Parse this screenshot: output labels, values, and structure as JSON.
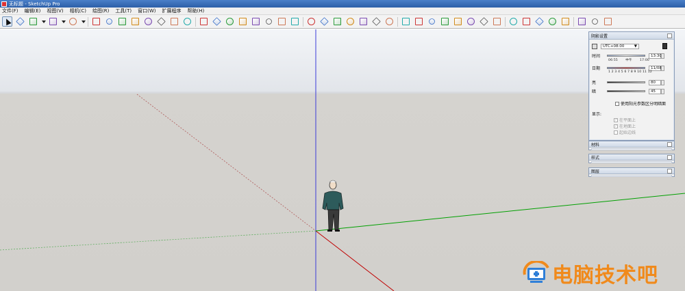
{
  "window": {
    "title": "无标题 - SketchUp Pro"
  },
  "menu": [
    "文件(F)",
    "编辑(E)",
    "视图(V)",
    "相机(C)",
    "绘图(R)",
    "工具(T)",
    "窗口(W)",
    "扩展程序",
    "帮助(H)"
  ],
  "toolbar": {
    "tools": [
      "select-icon",
      "eraser-icon",
      "pencil-icon",
      "dropdown-icon",
      "arc-icon",
      "dropdown-icon",
      "rectangle-icon",
      "dropdown-icon",
      "push-pull-icon",
      "offset-icon",
      "move-icon",
      "rotate-icon",
      "scale-icon",
      "tape-measure-icon",
      "text-icon",
      "protractor-icon",
      "paint-bucket-icon",
      "orbit-icon",
      "pan-icon",
      "zoom-icon",
      "zoom-extents-icon",
      "components-icon",
      "warehouse-icon",
      "extension-icon",
      "section-icon",
      "view-iso-icon",
      "view-top-icon",
      "view-front-icon",
      "view-right-icon",
      "view-back-icon",
      "view-left-icon",
      "sandbox-icon",
      "smoove-icon",
      "stamp-icon",
      "drape-icon",
      "add-detail-icon",
      "flip-edge-icon",
      "follow-me-icon",
      "intersect-icon",
      "solid-union-icon",
      "solid-subtract-icon",
      "solid-trim-icon",
      "solid-split-icon",
      "outer-shell-icon",
      "shadows-icon",
      "fog-icon",
      "layout-icon"
    ],
    "selected_tool": 0
  },
  "colors": {
    "blue_axis": "#1a1ad0",
    "red_axis": "#c00000",
    "green_axis": "#00a000",
    "watermark": "#f08a1c"
  },
  "shadow_panel": {
    "title": "阴影设置",
    "timezone": "UTC+08:00",
    "time_label": "时间",
    "time_start": "06:55",
    "time_noon": "中午",
    "time_end": "17:00",
    "time_value": "13:30",
    "date_label": "日期",
    "months": "1 2 3 4 5 6 7 8 9 10 11 12",
    "date_value": "11/08",
    "light_label": "亮",
    "light_value": "80",
    "dark_label": "暗",
    "dark_value": "45",
    "use_sun_label": "使用阳光参数区分明暗面",
    "display_label": "显示:",
    "display_options": [
      "在平面上",
      "在地面上",
      "起始边线"
    ]
  },
  "panels": [
    "材料",
    "样式",
    "图层"
  ],
  "watermark": "电脑技术吧"
}
